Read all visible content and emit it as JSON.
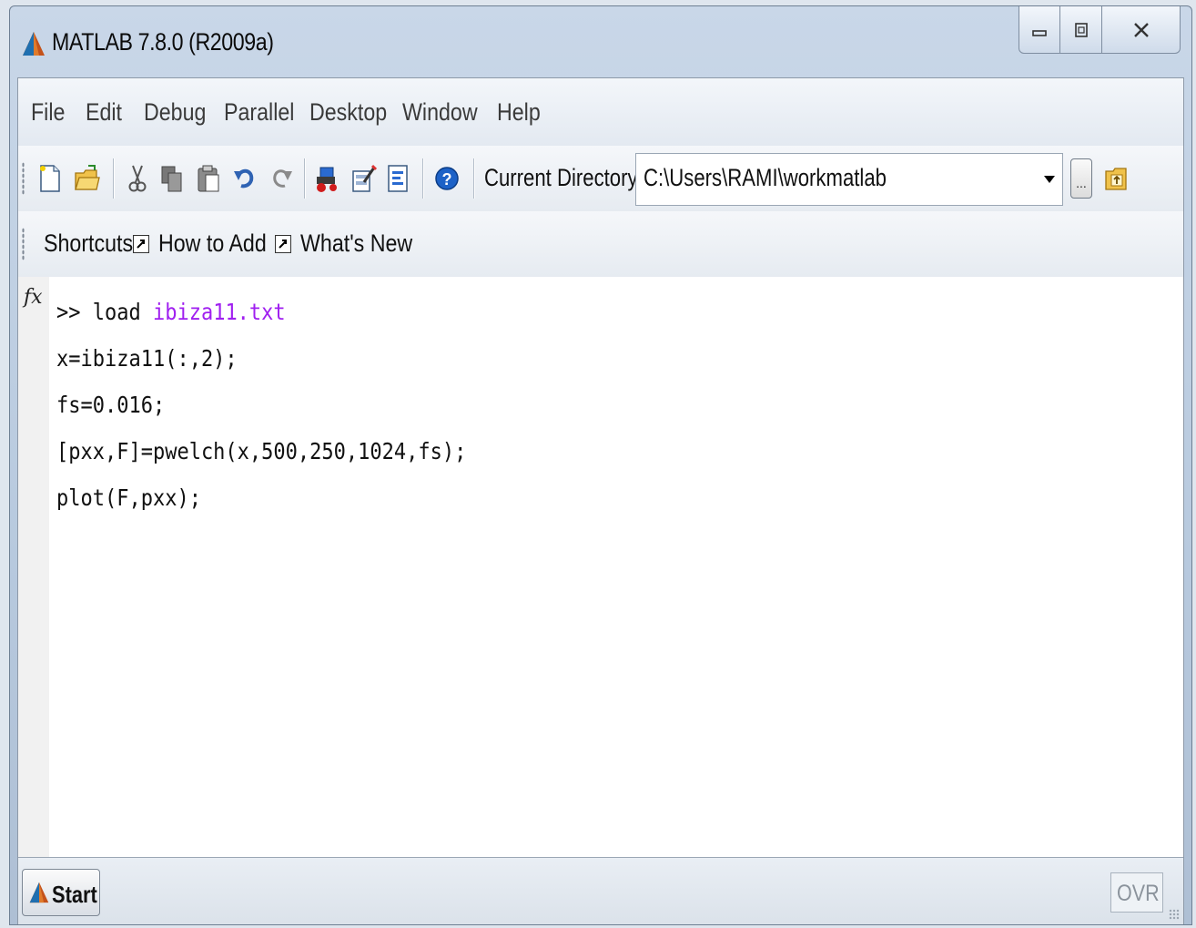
{
  "window": {
    "title": "MATLAB  7.8.0 (R2009a)",
    "controls": [
      "minimize-icon",
      "maximize-icon",
      "close-icon"
    ]
  },
  "menu": {
    "items": [
      "File",
      "Edit",
      "Debug",
      "Parallel",
      "Desktop",
      "Window",
      "Help"
    ]
  },
  "toolbar": {
    "icons": [
      "new-file-icon",
      "open-folder-icon",
      "cut-icon",
      "copy-icon",
      "paste-icon",
      "undo-icon",
      "redo-icon",
      "simulink-icon",
      "guide-icon",
      "profiler-icon",
      "help-icon"
    ],
    "current_directory_label": "Current Directory:",
    "current_directory_value": "C:\\Users\\RAMI\\workmatlab",
    "browse_label": "..."
  },
  "shortcuts": {
    "label": "Shortcuts",
    "items": [
      "How to Add",
      "What's New"
    ]
  },
  "command_window": {
    "lines": [
      {
        "prompt": ">> ",
        "text": "load ",
        "string": "ibiza11.txt"
      },
      {
        "prompt": "",
        "text": "x=ibiza11(:,2);",
        "string": ""
      },
      {
        "prompt": "",
        "text": "fs=0.016;",
        "string": ""
      },
      {
        "prompt": "",
        "text": "[pxx,F]=pwelch(x,500,250,1024,fs);",
        "string": ""
      },
      {
        "prompt": "",
        "text": "plot(F,pxx);",
        "string": ""
      }
    ],
    "string_color": "#a020f0"
  },
  "status": {
    "start_label": "Start",
    "ovr_label": "OVR"
  }
}
